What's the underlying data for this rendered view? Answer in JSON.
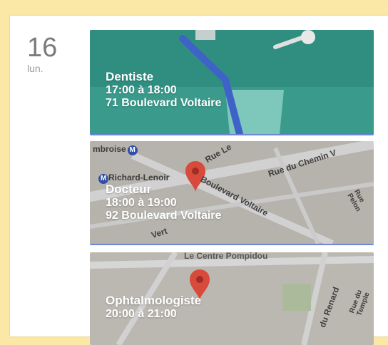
{
  "date": {
    "day": "16",
    "weekday": "lun."
  },
  "events": [
    {
      "title": "Dentiste",
      "time": "17:00 à 18:00",
      "address": "71 Boulevard Voltaire",
      "color": "#2f8e80"
    },
    {
      "title": "Docteur",
      "time": "18:00 à 19:00",
      "address": "92 Boulevard Voltaire",
      "map_labels": [
        "mbroise",
        "Richard-Lenoir",
        "Rue du Chemin V",
        "Rue Pelon",
        "Vert",
        "Rue Le",
        "Boulevard Voltaire"
      ]
    },
    {
      "title": "Ophtalmologiste",
      "time": "20:00 à 21:00",
      "map_labels": [
        "Le Centre Pompidou",
        "du Renard",
        "Rue du Temple"
      ]
    }
  ],
  "colors": {
    "background": "#fbe7a6",
    "accent_line": "#6e86d6",
    "pin": "#d84a3b"
  }
}
